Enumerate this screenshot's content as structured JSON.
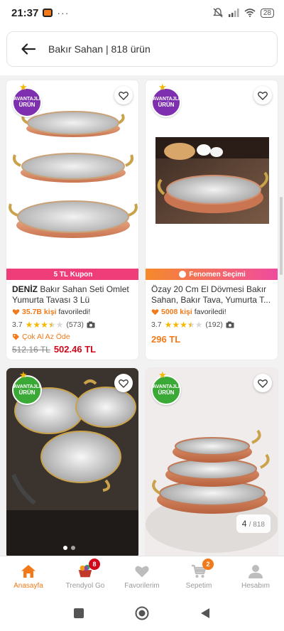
{
  "status_bar": {
    "time": "21:37",
    "more": "···",
    "battery": "28"
  },
  "search": {
    "text": "Bakır Sahan | 818 ürün"
  },
  "badge": {
    "line1": "AVANTAJLI",
    "line2": "ÜRÜN"
  },
  "products": [
    {
      "strip": "5 TL Kupon",
      "brand": "DENİZ",
      "name": " Bakır Sahan Seti Omlet Yumurta Tavası  3 Lü",
      "fav_count": "35.7B kişi",
      "fav_suffix": " favoriledi!",
      "rating": "3.7",
      "reviews": "(573)",
      "promo": "Çok Al Az Öde",
      "price_old": "512.16 TL",
      "price_new": "502.46 TL"
    },
    {
      "strip": "Fenomen Seçimi",
      "brand": "Özay",
      "name": " 20 Cm El Dövmesi Bakır Sahan, Bakır Tava, Yumurta T...",
      "fav_count": "5008 kişi",
      "fav_suffix": " favoriledi!",
      "rating": "3.7",
      "reviews": "(192)",
      "price": "296 TL"
    },
    {
      "dots_active": 1
    },
    {
      "page_current": "4",
      "page_total": "/ 818"
    }
  ],
  "nav": [
    {
      "label": "Anasayfa",
      "icon": "home-icon",
      "active": true
    },
    {
      "label": "Trendyol Go",
      "icon": "trendyol-go-icon",
      "badge": "8"
    },
    {
      "label": "Favorilerim",
      "icon": "heart-icon"
    },
    {
      "label": "Sepetim",
      "icon": "cart-icon",
      "badge": "2"
    },
    {
      "label": "Hesabım",
      "icon": "user-icon"
    }
  ],
  "colors": {
    "brand_orange": "#f27a1a",
    "price_red": "#d1071a",
    "kupon_pink": "#ef3d7a",
    "avantajli_purple": "#7e2fb0",
    "avantajli_green": "#3aa935"
  }
}
